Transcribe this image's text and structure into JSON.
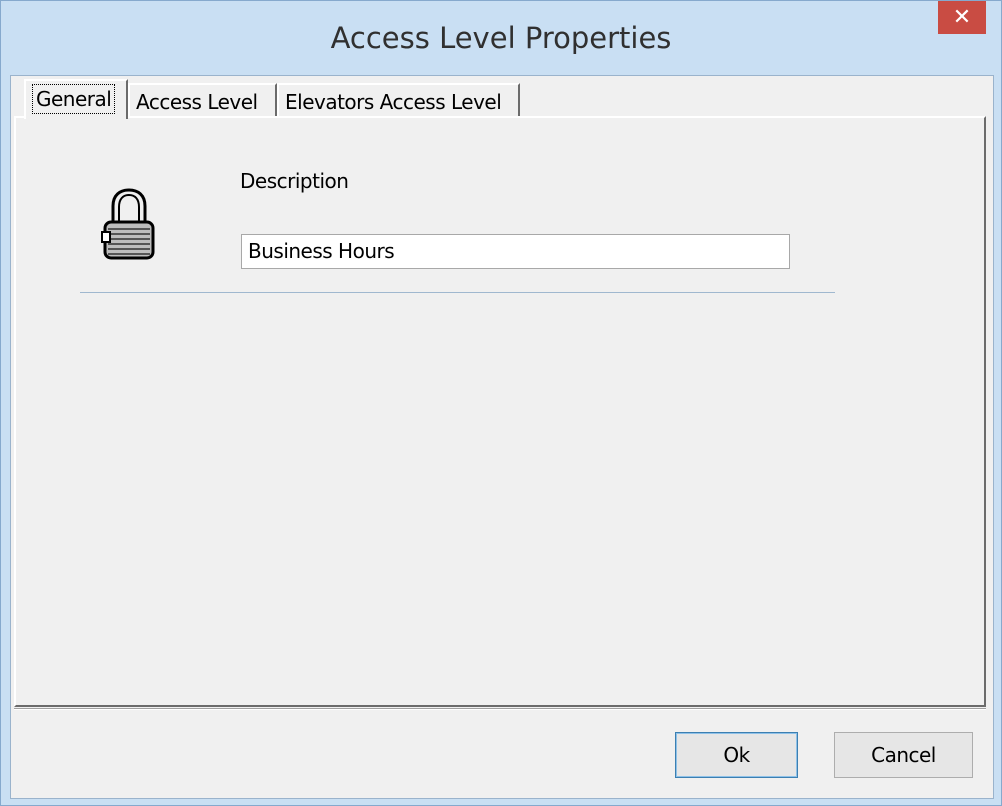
{
  "window": {
    "title": "Access Level Properties",
    "close_glyph": "✕"
  },
  "tabs": [
    {
      "label": "General",
      "active": true
    },
    {
      "label": "Access Level",
      "active": false
    },
    {
      "label": "Elevators Access Level",
      "active": false
    }
  ],
  "general": {
    "icon": "lock-icon",
    "description_label": "Description",
    "description_value": "Business Hours"
  },
  "buttons": {
    "ok_label": "Ok",
    "cancel_label": "Cancel"
  },
  "colors": {
    "frame": "#c9dff3",
    "close_button": "#c94c43",
    "dialog_face": "#f0f0f0"
  }
}
